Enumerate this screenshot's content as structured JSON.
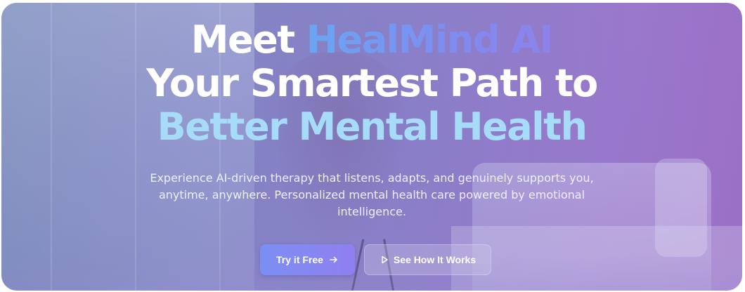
{
  "hero": {
    "headline": {
      "line1_prefix": "Meet",
      "line1_brand": "HealMind AI",
      "line2": "Your Smartest Path to",
      "line3": "Better Mental Health"
    },
    "subtitle": "Experience AI-driven therapy that listens, adapts, and genuinely supports you, anytime, anywhere. Personalized mental health care powered by emotional intelligence.",
    "primary_button": {
      "label": "Try it Free",
      "icon": "arrow-right-icon"
    },
    "secondary_button": {
      "label": "See How It Works",
      "icon": "play-icon"
    }
  },
  "colors": {
    "brand_gradient_start": "#6aa6f2",
    "brand_gradient_end": "#8d82ea",
    "highlight_text": "#a6dcf7",
    "primary_button": "#8586f1",
    "background_tint": "#8a80c6"
  }
}
